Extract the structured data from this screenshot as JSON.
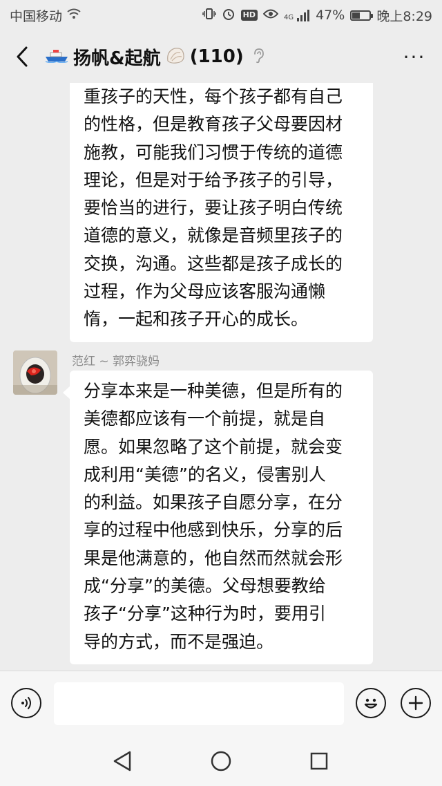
{
  "status_bar": {
    "carrier": "中国移动",
    "battery_percent": "47%",
    "battery_level": 0.47,
    "time": "晚上8:29",
    "network": "4G",
    "icons": [
      "vibrate-icon",
      "alarm-icon",
      "hd-icon",
      "eye-icon",
      "signal-icon",
      "battery-icon"
    ],
    "hd_label": "HD"
  },
  "header": {
    "title": "扬帆&起航",
    "member_count": "(110)",
    "icons": [
      "back-icon",
      "ship-emoji-icon",
      "shell-emoji-icon",
      "ear-icon",
      "more-icon"
    ],
    "more_label": "···"
  },
  "messages": [
    {
      "sender": "",
      "text": "重孩子的天性，每个孩子都有自己\n的性格，但是教育孩子父母要因材\n施教，可能我们习惯于传统的道德\n理论，但是对于给予孩子的引导，\n要恰当的进行，要让孩子明白传统\n道德的意义，就像是音频里孩子的\n交换，沟通。这些都是孩子成长的\n过程，作为父母应该客服沟通懒\n惰，一起和孩子开心的成长。"
    },
    {
      "sender": "范红 ~ 郭弈骁妈",
      "text": "分享本来是一种美德，但是所有的\n美德都应该有一个前提，就是自\n愿。如果忽略了这个前提，就会变\n成利用“美德”的名义，侵害别人\n的利益。如果孩子自愿分享，在分\n享的过程中他感到快乐，分享的后\n果是他满意的，他自然而然就会形\n成“分享”的美德。父母想要教给\n孩子“分享”这种行为时，要用引\n导的方式，而不是强迫。"
    }
  ],
  "input_bar": {
    "value": "",
    "icons": [
      "voice-icon",
      "emoji-icon",
      "plus-icon"
    ]
  },
  "nav_bar": {
    "icons": [
      "nav-back-icon",
      "nav-home-icon",
      "nav-recent-icon"
    ]
  },
  "colors": {
    "background": "#ededed",
    "bubble": "#ffffff",
    "text": "#111111",
    "sender_name": "#8a8a8a"
  }
}
